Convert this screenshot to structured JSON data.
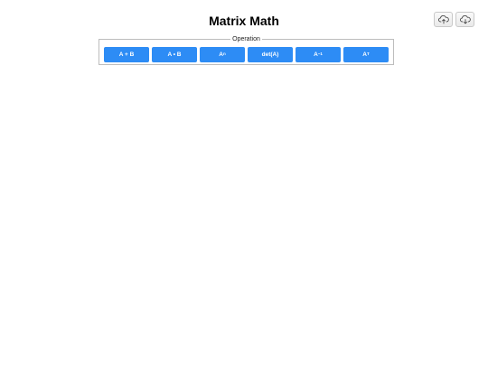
{
  "header": {
    "title": "Matrix Math"
  },
  "toolbar": {
    "upload_icon": "cloud-upload-icon",
    "download_icon": "cloud-download-icon"
  },
  "operation": {
    "legend": "Operation",
    "buttons": [
      {
        "base": "A + B",
        "sup": ""
      },
      {
        "base": "A • B",
        "sup": ""
      },
      {
        "base": "A",
        "sup": "n"
      },
      {
        "base": "det(A)",
        "sup": ""
      },
      {
        "base": "A",
        "sup": "−1"
      },
      {
        "base": "A",
        "sup": "T"
      }
    ],
    "button_color": "#2d8cf5"
  }
}
